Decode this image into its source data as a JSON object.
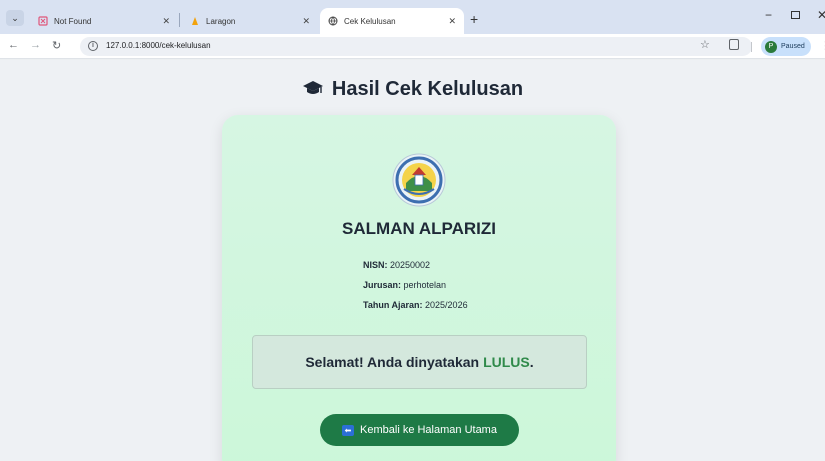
{
  "browser": {
    "tabs": [
      {
        "title": "Not Found",
        "active": false
      },
      {
        "title": "Laragon",
        "active": false
      },
      {
        "title": "Cek Kelulusan",
        "active": true
      }
    ],
    "url": "127.0.0.1:8000/cek-kelulusan",
    "profile_initial": "P",
    "profile_status": "Paused"
  },
  "page": {
    "title": "Hasil Cek Kelulusan",
    "student": {
      "name": "SALMAN ALPARIZI",
      "nisn_label": "NISN:",
      "nisn": "20250002",
      "jurusan_label": "Jurusan:",
      "jurusan": "perhotelan",
      "tahun_label": "Tahun Ajaran:",
      "tahun": "2025/2026"
    },
    "result": {
      "prefix": "Selamat! Anda dinyatakan",
      "status": "LULUS",
      "suffix": "."
    },
    "back_button": "Kembali ke Halaman Utama"
  },
  "colors": {
    "accent_green": "#1e7a46",
    "lulus_green": "#2f8a4a",
    "card_bg": "#d6f6e3"
  }
}
